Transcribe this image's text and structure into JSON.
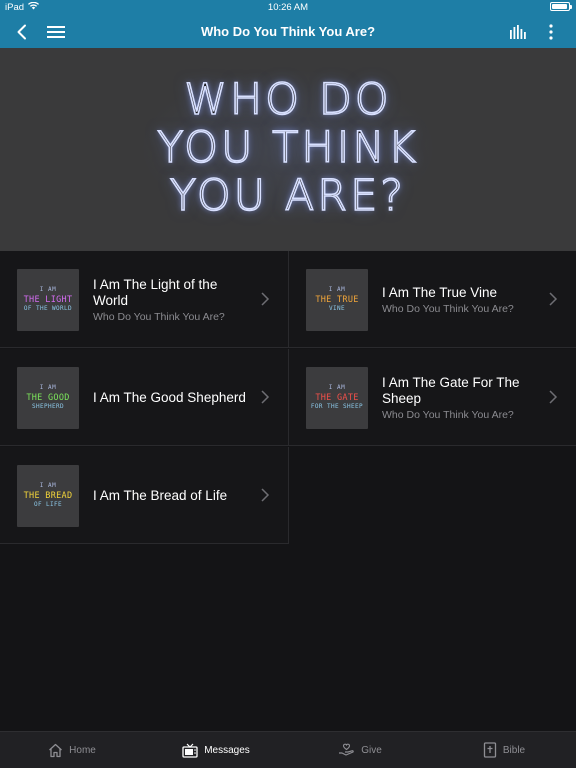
{
  "status_bar": {
    "device": "iPad",
    "time": "10:26 AM",
    "battery_level": 0.95
  },
  "nav": {
    "title": "Who Do You Think You Are?",
    "back_icon": "chevron-left-icon",
    "menu_icon": "hamburger-menu-icon",
    "audio_icon": "audio-bars-icon",
    "more_icon": "more-vertical-icon"
  },
  "hero": {
    "text": "WHO DO\nYOU THINK\nYOU ARE?"
  },
  "series_items": [
    {
      "title": "I Am The Light of the World",
      "subtitle": "Who Do You Think You Are?",
      "thumb": {
        "line1": "I AM",
        "line2": "THE LIGHT",
        "line3": "OF THE WORLD",
        "color": "#d36cf0"
      }
    },
    {
      "title": "I Am The True Vine",
      "subtitle": "Who Do You Think You Are?",
      "thumb": {
        "line1": "I AM",
        "line2": "THE TRUE",
        "line3": "VINE",
        "color": "#f0a53a"
      }
    },
    {
      "title": "I Am The Good Shepherd",
      "subtitle": "",
      "thumb": {
        "line1": "I AM",
        "line2": "THE GOOD",
        "line3": "SHEPHERD",
        "color": "#7be35a"
      }
    },
    {
      "title": "I Am The Gate For The Sheep",
      "subtitle": "Who Do You Think You Are?",
      "thumb": {
        "line1": "I AM",
        "line2": "THE GATE",
        "line3": "FOR THE SHEEP",
        "color": "#f0504a"
      }
    },
    {
      "title": "I Am The Bread of Life",
      "subtitle": "",
      "thumb": {
        "line1": "I AM",
        "line2": "THE BREAD",
        "line3": "OF LIFE",
        "color": "#f2d43a"
      }
    }
  ],
  "tabs": [
    {
      "label": "Home",
      "icon": "home-icon",
      "active": false
    },
    {
      "label": "Messages",
      "icon": "tv-icon",
      "active": true
    },
    {
      "label": "Give",
      "icon": "give-hand-icon",
      "active": false
    },
    {
      "label": "Bible",
      "icon": "bible-book-icon",
      "active": false
    }
  ],
  "colors": {
    "accent": "#1e7ea6",
    "background": "#141416"
  }
}
